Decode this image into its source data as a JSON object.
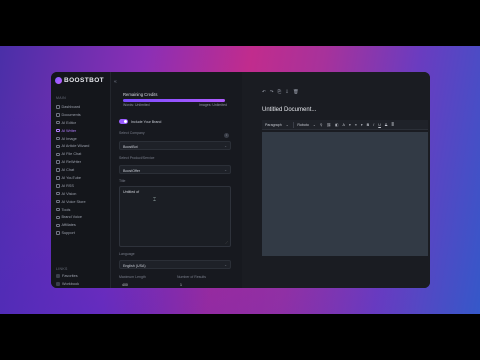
{
  "app": {
    "logo_text": "BOOSTBOT",
    "collapse_icon": "«"
  },
  "sidebar": {
    "section1": "MAIN",
    "items": [
      {
        "label": "Dashboard",
        "active": false
      },
      {
        "label": "Documents",
        "active": false
      },
      {
        "label": "AI Editor",
        "active": false
      },
      {
        "label": "AI Writer",
        "active": true
      },
      {
        "label": "AI Image",
        "active": false
      },
      {
        "label": "AI Article Wizard",
        "active": false
      },
      {
        "label": "AI File Chat",
        "active": false
      },
      {
        "label": "AI ReWriter",
        "active": false
      },
      {
        "label": "AI Chat",
        "active": false
      },
      {
        "label": "AI YouTube",
        "active": false
      },
      {
        "label": "AI RSS",
        "active": false
      },
      {
        "label": "AI Vision",
        "active": false
      },
      {
        "label": "AI Voice Store",
        "active": false
      },
      {
        "label": "Tools",
        "active": false
      },
      {
        "label": "Brand Voice",
        "active": false
      },
      {
        "label": "Affiliates",
        "active": false
      },
      {
        "label": "Support",
        "active": false
      }
    ],
    "section2": "LINKS",
    "links": [
      {
        "label": "Favorites"
      },
      {
        "label": "Workbook"
      }
    ]
  },
  "credits": {
    "title": "Remaining Credits",
    "fill_fraction": 1.0,
    "words": "Words: Unlimited",
    "images": "Images: Unlimited"
  },
  "form": {
    "toggle_label": "Include Your Brand",
    "select_company_label": "Select Company",
    "select_company_value": "BoostBot",
    "select_product_label": "Select Product/Service",
    "select_product_value": "BoostOffer",
    "prompt_label": "Title",
    "prompt_value": "Untitled of",
    "language_label": "Language",
    "language_value": "English (USA)",
    "max_length_label": "Maximum Length",
    "max_length_value": "400",
    "results_label": "Number of Results",
    "results_value": "1",
    "info_icon": "i"
  },
  "editor": {
    "tools": [
      "↶",
      "↷",
      "⎘",
      "⇩",
      "🗑"
    ],
    "doc_title": "Untitled Document...",
    "fmt_paragraph": "Paragraph",
    "fmt_font": "Roboto",
    "fmt_items": [
      "⚲",
      "⛓",
      "◧",
      "A",
      "▾",
      "≡",
      "▾",
      "B",
      "I",
      "U",
      "S",
      "≣"
    ]
  }
}
